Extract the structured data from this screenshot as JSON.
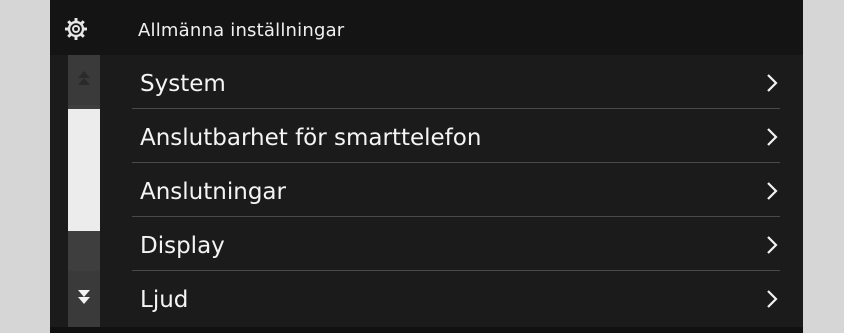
{
  "header": {
    "title": "Allmänna inställningar",
    "icon": "gear-icon"
  },
  "scrollbar": {
    "up_icon": "scroll-up-icon",
    "down_icon": "scroll-down-icon"
  },
  "menu": {
    "items": [
      {
        "label": "System",
        "icon": "chevron-right-icon"
      },
      {
        "label": "Anslutbarhet för smarttelefon",
        "icon": "chevron-right-icon"
      },
      {
        "label": "Anslutningar",
        "icon": "chevron-right-icon"
      },
      {
        "label": "Display",
        "icon": "chevron-right-icon"
      },
      {
        "label": "Ljud",
        "icon": "chevron-right-icon"
      }
    ]
  },
  "colors": {
    "background": "#1b1b1b",
    "text": "#f4f4f4",
    "divider": "#4a4a4a",
    "scroll_thumb": "#ececec"
  }
}
